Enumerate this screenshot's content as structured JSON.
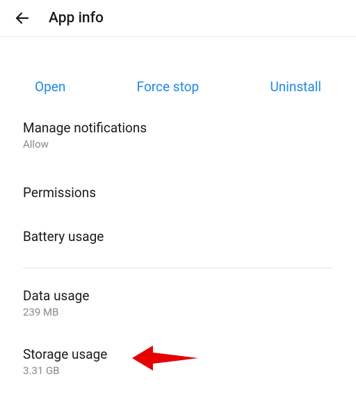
{
  "header": {
    "title": "App info"
  },
  "actions": {
    "open": "Open",
    "force_stop": "Force stop",
    "uninstall": "Uninstall"
  },
  "settings": {
    "manage_notifications": {
      "label": "Manage notifications",
      "sub": "Allow"
    },
    "permissions": {
      "label": "Permissions"
    },
    "battery": {
      "label": "Battery usage"
    },
    "data_usage": {
      "label": "Data usage",
      "sub": "239 MB"
    },
    "storage_usage": {
      "label": "Storage usage",
      "sub": "3.31 GB"
    }
  },
  "annotation": {
    "arrow_color": "#e60000"
  }
}
